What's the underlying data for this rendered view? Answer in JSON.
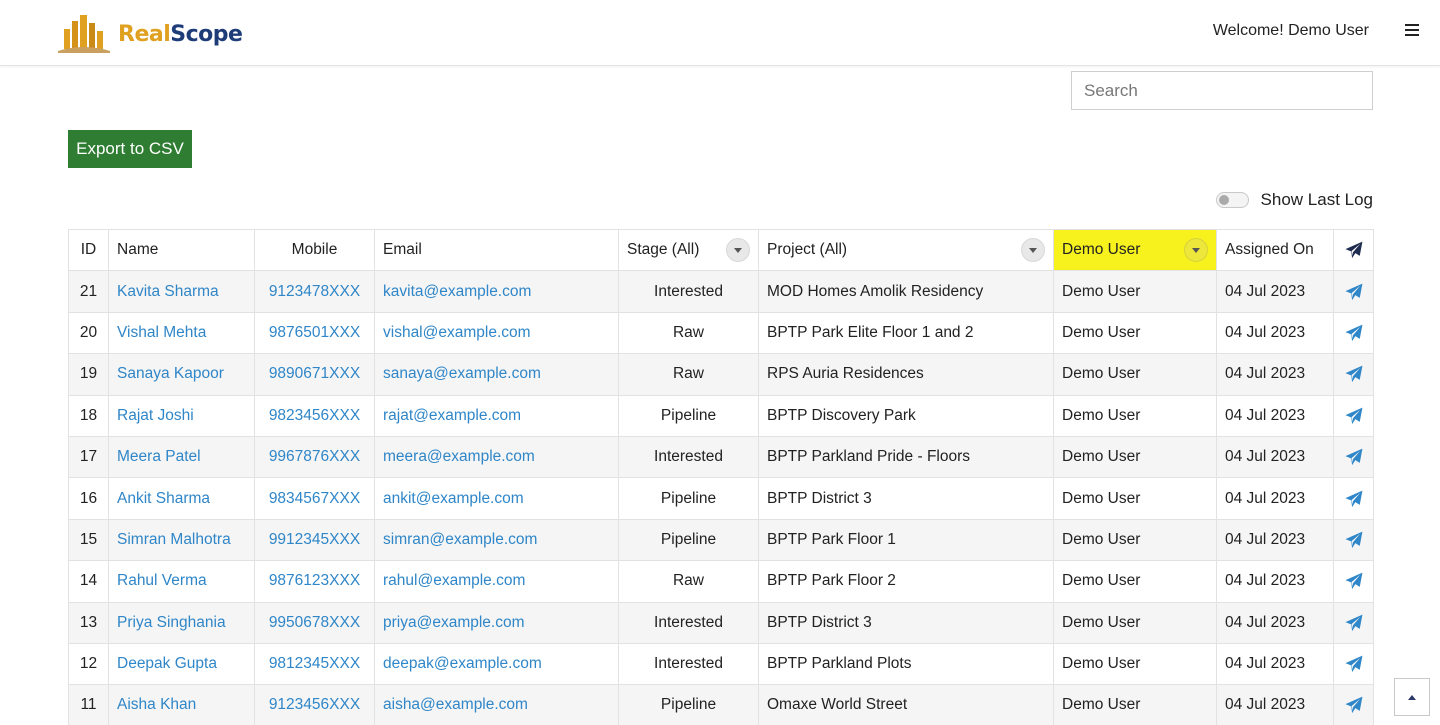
{
  "brand": {
    "name_part1": "Real",
    "name_part2": "Scope",
    "accent": "#e0a020",
    "primary": "#1d3c78"
  },
  "header": {
    "welcome_text": "Welcome! Demo User",
    "menu_icon": "hamburger-icon"
  },
  "search": {
    "placeholder": "Search",
    "value": ""
  },
  "toolbar": {
    "export_label": "Export to CSV",
    "export_color": "#2f7d32"
  },
  "toggle": {
    "label": "Show Last Log",
    "checked": false
  },
  "table": {
    "headers": {
      "id": "ID",
      "name": "Name",
      "mobile": "Mobile",
      "email": "Email",
      "stage": "Stage (All)",
      "project": "Project (All)",
      "user": "Demo User",
      "assigned": "Assigned On",
      "action_icon": "send-icon"
    },
    "user_header_color": "#f7f21e",
    "link_color": "#2f86c8",
    "rows": [
      {
        "id": "21",
        "name": "Kavita Sharma",
        "mobile": "9123478XXX",
        "email": "kavita@example.com",
        "stage": "Interested",
        "project": "MOD Homes Amolik Residency",
        "user": "Demo User",
        "assigned": "04 Jul 2023"
      },
      {
        "id": "20",
        "name": "Vishal Mehta",
        "mobile": "9876501XXX",
        "email": "vishal@example.com",
        "stage": "Raw",
        "project": "BPTP Park Elite Floor 1 and 2",
        "user": "Demo User",
        "assigned": "04 Jul 2023"
      },
      {
        "id": "19",
        "name": "Sanaya Kapoor",
        "mobile": "9890671XXX",
        "email": "sanaya@example.com",
        "stage": "Raw",
        "project": "RPS Auria Residences",
        "user": "Demo User",
        "assigned": "04 Jul 2023"
      },
      {
        "id": "18",
        "name": "Rajat Joshi",
        "mobile": "9823456XXX",
        "email": "rajat@example.com",
        "stage": "Pipeline",
        "project": "BPTP Discovery Park",
        "user": "Demo User",
        "assigned": "04 Jul 2023"
      },
      {
        "id": "17",
        "name": "Meera Patel",
        "mobile": "9967876XXX",
        "email": "meera@example.com",
        "stage": "Interested",
        "project": "BPTP Parkland Pride - Floors",
        "user": "Demo User",
        "assigned": "04 Jul 2023"
      },
      {
        "id": "16",
        "name": "Ankit Sharma",
        "mobile": "9834567XXX",
        "email": "ankit@example.com",
        "stage": "Pipeline",
        "project": "BPTP District 3",
        "user": "Demo User",
        "assigned": "04 Jul 2023"
      },
      {
        "id": "15",
        "name": "Simran Malhotra",
        "mobile": "9912345XXX",
        "email": "simran@example.com",
        "stage": "Pipeline",
        "project": "BPTP Park Floor 1",
        "user": "Demo User",
        "assigned": "04 Jul 2023"
      },
      {
        "id": "14",
        "name": "Rahul Verma",
        "mobile": "9876123XXX",
        "email": "rahul@example.com",
        "stage": "Raw",
        "project": "BPTP Park Floor 2",
        "user": "Demo User",
        "assigned": "04 Jul 2023"
      },
      {
        "id": "13",
        "name": "Priya Singhania",
        "mobile": "9950678XXX",
        "email": "priya@example.com",
        "stage": "Interested",
        "project": "BPTP District 3",
        "user": "Demo User",
        "assigned": "04 Jul 2023"
      },
      {
        "id": "12",
        "name": "Deepak Gupta",
        "mobile": "9812345XXX",
        "email": "deepak@example.com",
        "stage": "Interested",
        "project": "BPTP Parkland Plots",
        "user": "Demo User",
        "assigned": "04 Jul 2023"
      },
      {
        "id": "11",
        "name": "Aisha Khan",
        "mobile": "9123456XXX",
        "email": "aisha@example.com",
        "stage": "Pipeline",
        "project": "Omaxe World Street",
        "user": "Demo User",
        "assigned": "04 Jul 2023"
      }
    ]
  },
  "scroll_top_icon": "chevron-up-icon"
}
